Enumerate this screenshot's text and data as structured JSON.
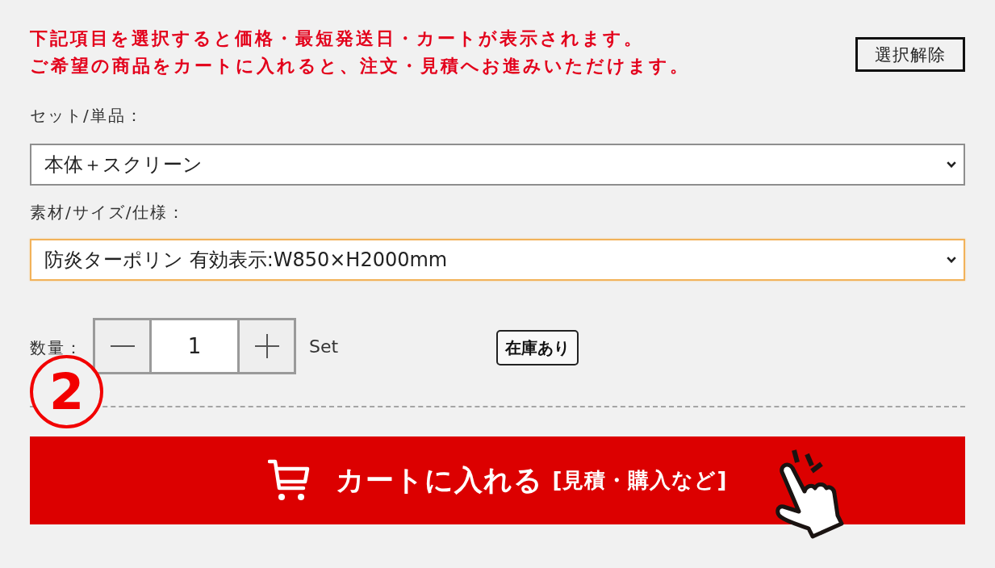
{
  "notice": [
    "下記項目を選択すると価格・最短発送日・カートが表示されます。",
    "ご希望の商品をカートに入れると、注文・見積へお進みいただけます。"
  ],
  "clear_button": {
    "label": "選択解除"
  },
  "options": [
    {
      "label": "セット/単品：",
      "value": "本体＋スクリーン",
      "focused": false
    },
    {
      "label": "素材/サイズ/仕様：",
      "value": "防炎ターポリン 有効表示:W850×H2000mm",
      "focused": true
    }
  ],
  "quantity": {
    "label": "数量：",
    "value": "1",
    "unit": "Set"
  },
  "stock_badge": "在庫あり",
  "step_marker": "2",
  "cart_button": {
    "label": "カートに入れる",
    "sublabel": "[見積・購入など]"
  }
}
